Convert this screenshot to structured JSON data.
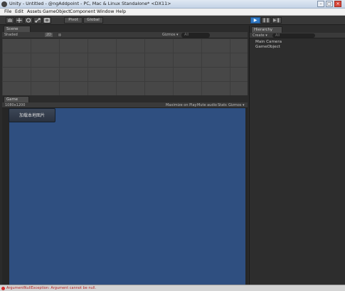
{
  "window": {
    "title": "Unity - Untitled - @ngAddpoint - PC, Mac & Linux Standalone* <DX11>",
    "controls": [
      "–",
      "□",
      "×"
    ]
  },
  "menu": {
    "items": [
      "File",
      "Edit",
      "Assets",
      "GameObject",
      "Component",
      "Window",
      "Help"
    ]
  },
  "toolbar": {
    "tools": [
      "hand-icon",
      "move-icon",
      "rotate-icon",
      "scale-icon",
      "rect-icon"
    ],
    "pivot_label": "Pivot",
    "global_label": "Global",
    "play": [
      "▶",
      "❚❚",
      "▶❚"
    ]
  },
  "scene": {
    "tab_label": "Scene",
    "shading_label": "Shaded",
    "mode_label": "2D",
    "gizmos_label": "Gizmos ▾",
    "search_placeholder": "All"
  },
  "game": {
    "tab_label": "Game",
    "resolution_label": "1080x1200",
    "options": [
      "Maximize on Play",
      "Mute audio",
      "Stats",
      "Gizmos ▾"
    ],
    "load_button_label": "加载本地图片"
  },
  "hierarchy": {
    "tab_label": "Hierarchy",
    "create_label": "Create ▾",
    "search_placeholder": "All",
    "items": [
      "Main Camera",
      "GameObject"
    ]
  },
  "status": {
    "message": "ArgumentNullException: Argument cannot be null."
  },
  "colors": {
    "game_background": "#2f4f80",
    "play_button": "#2f78c4",
    "error": "#d12b2b"
  }
}
